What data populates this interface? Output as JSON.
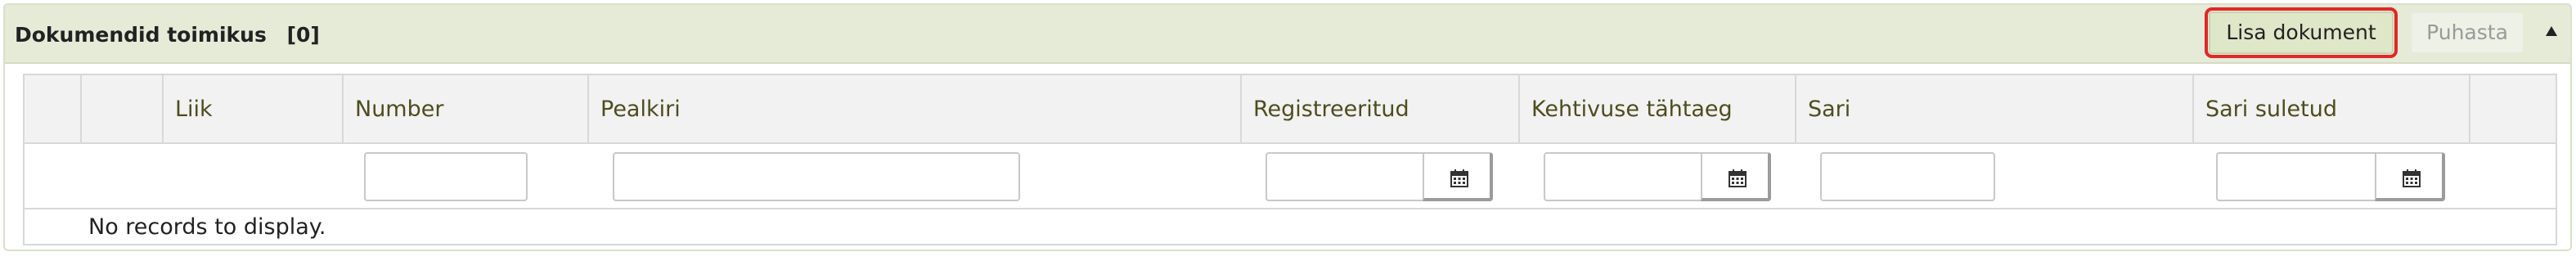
{
  "panel": {
    "title": "Dokumendid toimikus",
    "count": "[0]",
    "add_button_label": "Lisa dokument",
    "clear_button_label": "Puhasta",
    "collapse_icon": "triangle-up-icon"
  },
  "table": {
    "columns": [
      "",
      "",
      "Liik",
      "Number",
      "Pealkiri",
      "Registreeritud",
      "Kehtivuse tähtaeg",
      "Sari",
      "Sari suletud",
      ""
    ],
    "filters": {
      "number": "",
      "pealkiri": "",
      "registreeritud": "",
      "kehtivuse_tahtaeg": "",
      "sari": "",
      "sari_suletud": ""
    },
    "empty_message": "No records to display."
  },
  "colors": {
    "header_bg": "#e6ebd8",
    "add_button_bg": "#dfe7c9",
    "add_button_outline": "#e02828",
    "column_text": "#4d4d1f"
  }
}
